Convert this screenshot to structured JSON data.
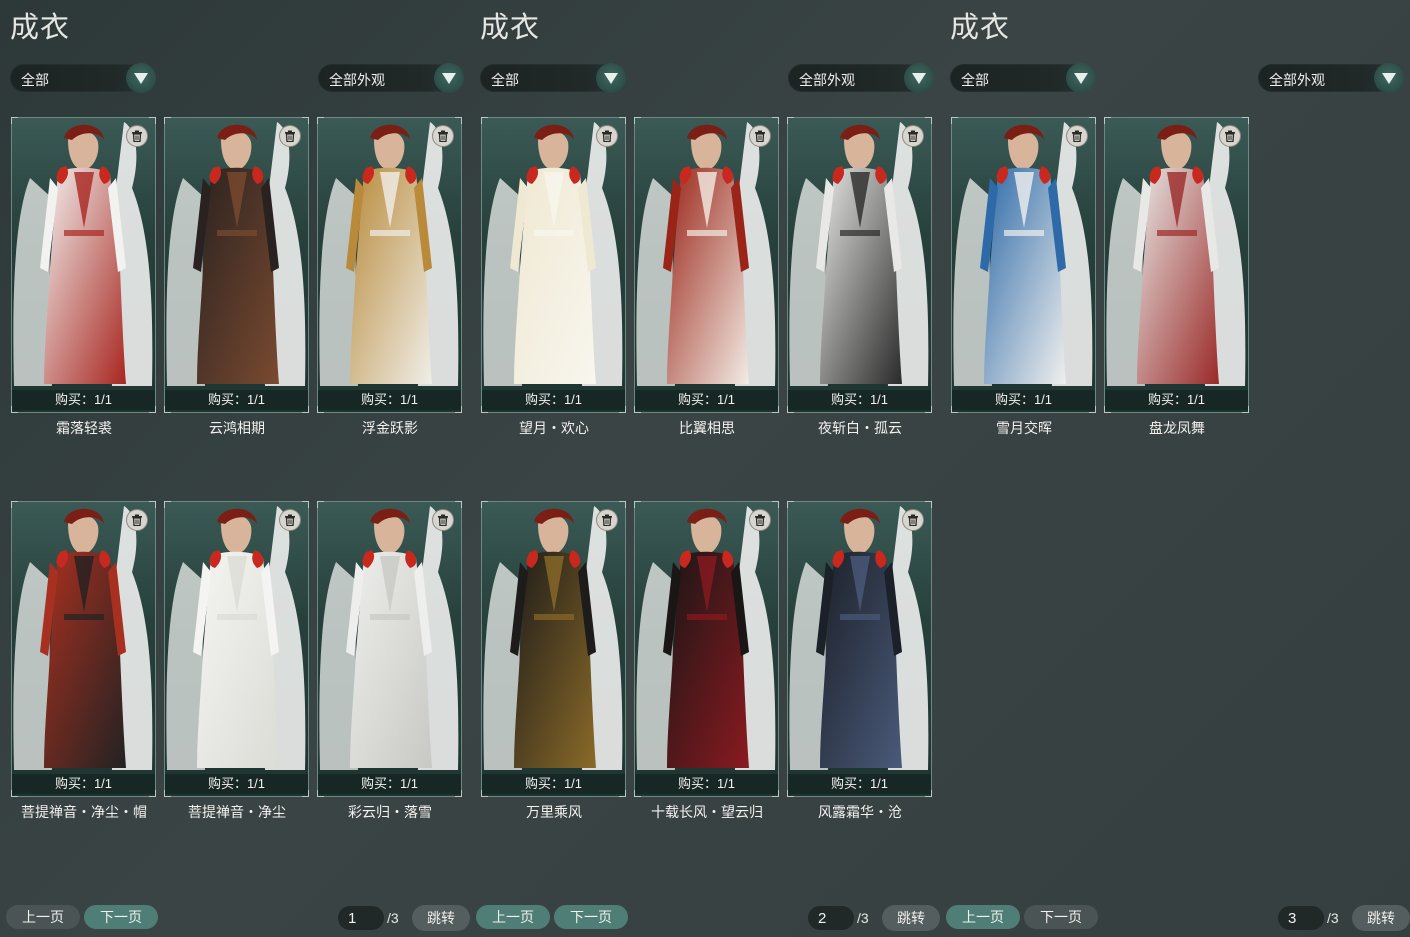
{
  "panels": [
    {
      "title": "成衣",
      "filter_left": "全部",
      "filter_right": "全部外观",
      "items": [
        {
          "name": "霜落轻裘",
          "buy": "购买：1/1",
          "colors": [
            "#f2f2f0",
            "#a82620"
          ]
        },
        {
          "name": "云鸿相期",
          "buy": "购买：1/1",
          "colors": [
            "#2a2220",
            "#7a4a30"
          ]
        },
        {
          "name": "浮金跃影",
          "buy": "购买：1/1",
          "colors": [
            "#b88a3a",
            "#f0eee8"
          ]
        },
        {
          "name": "菩提禅音・净尘・帽",
          "buy": "购买：1/1",
          "colors": [
            "#a83020",
            "#222"
          ]
        },
        {
          "name": "菩提禅音・净尘",
          "buy": "购买：1/1",
          "colors": [
            "#f4f4f2",
            "#dcdcd6"
          ]
        },
        {
          "name": "彩云归・落雪",
          "buy": "购买：1/1",
          "colors": [
            "#eeeeec",
            "#c8c8c4"
          ]
        }
      ],
      "prev": "上一页",
      "next": "下一页",
      "page": "1",
      "total": "/3",
      "jump": "跳转"
    },
    {
      "title": "成衣",
      "filter_left": "全部",
      "filter_right": "全部外观",
      "items": [
        {
          "name": "望月・欢心",
          "buy": "购买：1/1",
          "colors": [
            "#efe8d2",
            "#f8f6ee"
          ]
        },
        {
          "name": "比翼相思",
          "buy": "购买：1/1",
          "colors": [
            "#9a2418",
            "#f2ece4"
          ]
        },
        {
          "name": "夜斩白・孤云",
          "buy": "购买：1/1",
          "colors": [
            "#e8e8e6",
            "#2a2a2a"
          ]
        },
        {
          "name": "万里乘风",
          "buy": "购买：1/1",
          "colors": [
            "#1e1c1a",
            "#8a6a28"
          ]
        },
        {
          "name": "十载长风・望云归",
          "buy": "购买：1/1",
          "colors": [
            "#1a1616",
            "#8a1a20"
          ]
        },
        {
          "name": "风露霜华・沧",
          "buy": "购买：1/1",
          "colors": [
            "#1c2028",
            "#4a5a7a"
          ]
        }
      ],
      "prev": "上一页",
      "next": "下一页",
      "page": "2",
      "total": "/3",
      "jump": "跳转"
    },
    {
      "title": "成衣",
      "filter_left": "全部",
      "filter_right": "全部外观",
      "items": [
        {
          "name": "雪月交晖",
          "buy": "购买：1/1",
          "colors": [
            "#2e6aa8",
            "#f0f0ee"
          ]
        },
        {
          "name": "盘龙凤舞",
          "buy": "购买：1/1",
          "colors": [
            "#e8e8e6",
            "#9a2a28"
          ]
        }
      ],
      "prev": "上一页",
      "next": "下一页",
      "page": "3",
      "total": "/3",
      "jump": "跳转"
    }
  ]
}
